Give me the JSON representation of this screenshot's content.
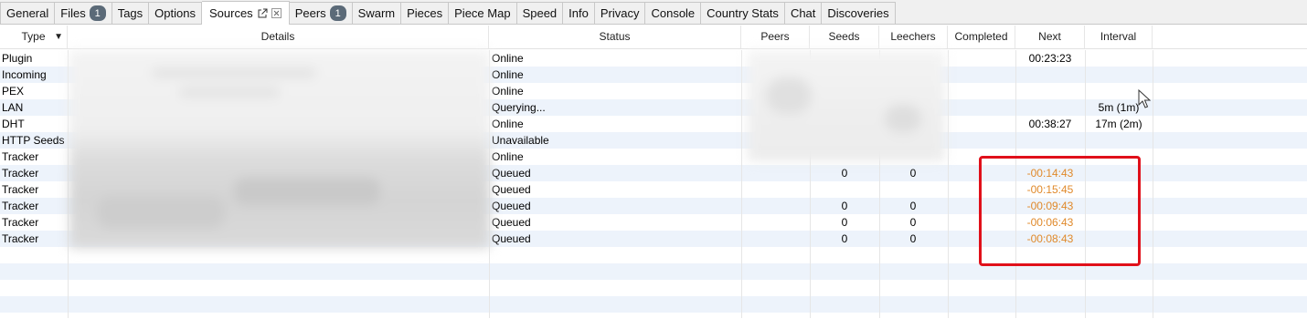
{
  "tabs": [
    {
      "label": "General"
    },
    {
      "label": "Files",
      "badge": "1"
    },
    {
      "label": "Tags"
    },
    {
      "label": "Options"
    },
    {
      "label": "Sources",
      "active": true
    },
    {
      "label": "Peers",
      "badge": "1"
    },
    {
      "label": "Swarm"
    },
    {
      "label": "Pieces"
    },
    {
      "label": "Piece Map"
    },
    {
      "label": "Speed"
    },
    {
      "label": "Info"
    },
    {
      "label": "Privacy"
    },
    {
      "label": "Console"
    },
    {
      "label": "Country Stats"
    },
    {
      "label": "Chat"
    },
    {
      "label": "Discoveries"
    }
  ],
  "table": {
    "columns": {
      "type": "Type",
      "details": "Details",
      "status": "Status",
      "peers": "Peers",
      "seeds": "Seeds",
      "leechers": "Leechers",
      "completed": "Completed",
      "next": "Next",
      "interval": "Interval"
    },
    "sort_column": "type",
    "rows": [
      {
        "type": "Plugin",
        "status": "Online",
        "seeds": "",
        "leechers": "",
        "next": "00:23:23",
        "interval": ""
      },
      {
        "type": "Incoming",
        "status": "Online",
        "seeds": "",
        "leechers": "",
        "next": "",
        "interval": ""
      },
      {
        "type": "PEX",
        "status": "Online",
        "seeds": "",
        "leechers": "",
        "next": "",
        "interval": ""
      },
      {
        "type": "LAN",
        "status": "Querying...",
        "seeds": "",
        "leechers": "",
        "next": "",
        "interval": "5m (1m)"
      },
      {
        "type": "DHT",
        "status": "Online",
        "seeds": "",
        "leechers": "",
        "next": "00:38:27",
        "interval": "17m (2m)"
      },
      {
        "type": "HTTP Seeds",
        "status": "Unavailable",
        "seeds": "",
        "leechers": "",
        "next": "",
        "interval": ""
      },
      {
        "type": "Tracker",
        "status": "Online",
        "seeds": "",
        "leechers": "",
        "next": "",
        "interval": ""
      },
      {
        "type": "Tracker",
        "status": "Queued",
        "seeds": "0",
        "leechers": "0",
        "next": "-00:14:43",
        "interval": ""
      },
      {
        "type": "Tracker",
        "status": "Queued",
        "seeds": "",
        "leechers": "",
        "next": "-00:15:45",
        "interval": ""
      },
      {
        "type": "Tracker",
        "status": "Queued",
        "seeds": "0",
        "leechers": "0",
        "next": "-00:09:43",
        "interval": ""
      },
      {
        "type": "Tracker",
        "status": "Queued",
        "seeds": "0",
        "leechers": "0",
        "next": "-00:06:43",
        "interval": ""
      },
      {
        "type": "Tracker",
        "status": "Queued",
        "seeds": "0",
        "leechers": "0",
        "next": "-00:08:43",
        "interval": ""
      }
    ]
  },
  "colors": {
    "negative_next": "#e0892a",
    "highlight_box": "#e0101a",
    "alt_row": "#edf3fb",
    "badge": "#5b6a78"
  },
  "icons": {
    "popout": "popout-icon",
    "close_tab": "close-icon",
    "sort": "sort-desc-icon",
    "cursor": "mouse-cursor-icon"
  }
}
